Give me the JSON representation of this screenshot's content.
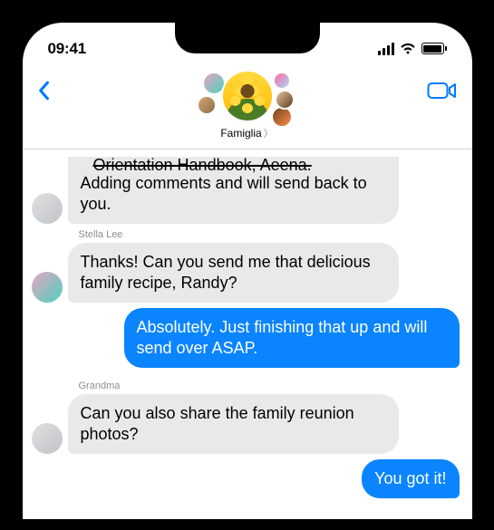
{
  "status": {
    "time": "09:41"
  },
  "colors": {
    "accent": "#007aff",
    "sent_bubble": "#0a84ff",
    "received_bubble": "#e9e9eb"
  },
  "header": {
    "group_name": "Famiglia"
  },
  "messages": [
    {
      "sender": "",
      "side": "received",
      "avatar_class": "av-grandma",
      "cut_line": "Orientation Handbook, Aeena.",
      "text": "Adding comments and will send back to you."
    },
    {
      "sender": "Stella Lee",
      "side": "received",
      "avatar_class": "av-stella",
      "text": "Thanks! Can you send me that delicious family recipe, Randy?"
    },
    {
      "sender": "",
      "side": "sent",
      "text": "Absolutely. Just finishing that up and will send over ASAP."
    },
    {
      "sender": "Grandma",
      "side": "received",
      "avatar_class": "av-grandma",
      "text": "Can you also share the family reunion photos?"
    },
    {
      "sender": "",
      "side": "sent",
      "text": "You got it!"
    }
  ]
}
